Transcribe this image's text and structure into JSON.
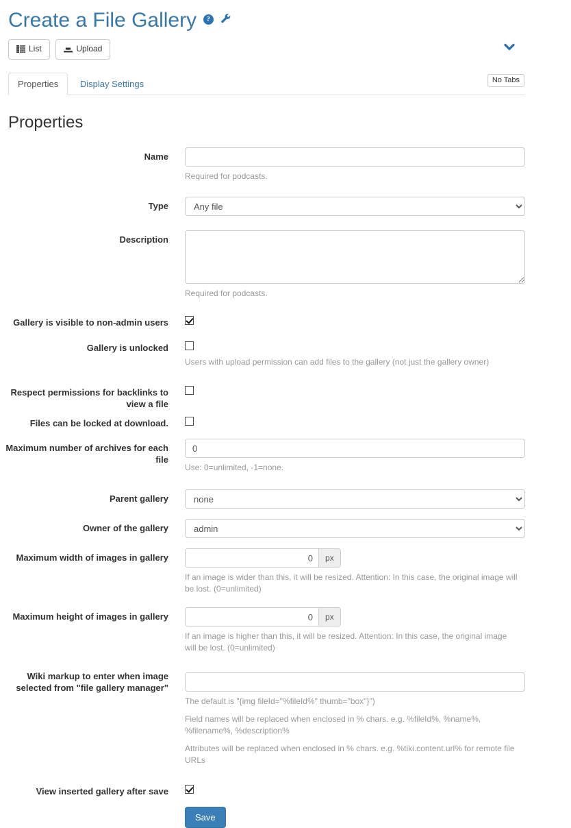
{
  "header": {
    "title": "Create a File Gallery",
    "help_icon": "help-circle-icon",
    "help_glyph": "?",
    "wrench_icon": "wrench-icon",
    "title_color": "#3878a8"
  },
  "toolbar": {
    "buttons": [
      {
        "label": "List",
        "icon": "list-icon"
      },
      {
        "label": "Upload",
        "icon": "upload-icon"
      }
    ],
    "toggle_icon": "chevron-down-icon",
    "toggle_color": "#2a6fb0"
  },
  "tabs": {
    "items": [
      {
        "label": "Properties",
        "active": true
      },
      {
        "label": "Display Settings",
        "active": false
      }
    ],
    "no_tabs_badge": "No Tabs"
  },
  "section": {
    "title": "Properties"
  },
  "form": {
    "name": {
      "label": "Name",
      "value": "",
      "placeholder": "",
      "help": "Required for podcasts."
    },
    "type": {
      "label": "Type",
      "value": "Any file",
      "options": [
        "Any file"
      ]
    },
    "description": {
      "label": "Description",
      "value": "",
      "placeholder": "",
      "help": "Required for podcasts."
    },
    "visible_non_admin": {
      "label": "Gallery is visible to non-admin users",
      "checked": true
    },
    "unlocked": {
      "label": "Gallery is unlocked",
      "checked": false,
      "help": "Users with upload permission can add files to the gallery (not just the gallery owner)"
    },
    "respect_permissions": {
      "label": "Respect permissions for backlinks to view a file",
      "checked": false
    },
    "lock_at_download": {
      "label": "Files can be locked at download.",
      "checked": false
    },
    "max_archives": {
      "label": "Maximum number of archives for each file",
      "value": "0",
      "help": "Use: 0=unlimited, -1=none."
    },
    "parent_gallery": {
      "label": "Parent gallery",
      "value": "none",
      "options": [
        "none"
      ]
    },
    "owner": {
      "label": "Owner of the gallery",
      "value": "admin",
      "options": [
        "admin"
      ]
    },
    "max_width": {
      "label": "Maximum width of images in gallery",
      "value": "0",
      "unit": "px",
      "help": "If an image is wider than this, it will be resized. Attention: In this case, the original image will be lost. (0=unlimited)"
    },
    "max_height": {
      "label": "Maximum height of images in gallery",
      "value": "0",
      "unit": "px",
      "help": "If an image is higher than this, it will be resized. Attention: In this case, the original image will be lost. (0=unlimited)"
    },
    "wiki_markup": {
      "label": "Wiki markup to enter when image selected from \"file gallery manager\"",
      "value": "",
      "help1": "The default is \"{img fileId=\"%fileId%\" thumb=\"box\"}\")",
      "help2": "Field names will be replaced when enclosed in % chars. e.g. %fileId%, %name%, %filename%, %description%",
      "help3": "Attributes will be replaced when enclosed in % chars. e.g. %tiki.content.url% for remote file URLs"
    },
    "view_after_save": {
      "label": "View inserted gallery after save",
      "checked": true
    },
    "save_button": {
      "label": "Save",
      "color": "#3a7fb8"
    }
  }
}
